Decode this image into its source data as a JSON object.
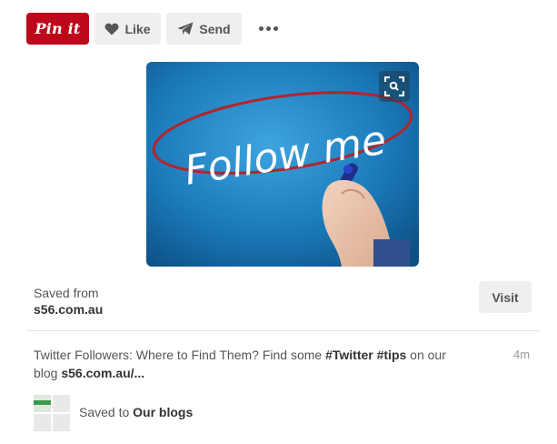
{
  "toolbar": {
    "pin_label": "Pin it",
    "like_label": "Like",
    "send_label": "Send"
  },
  "pin": {
    "image_text": "Follow me",
    "saved_from_label": "Saved from",
    "domain": "s56.com.au",
    "visit_label": "Visit",
    "description_text_1": "Twitter Followers: Where to Find Them? Find some ",
    "hashtag_1": "#Twitter",
    "hashtag_2": "#tips",
    "description_text_2": " on our blog ",
    "description_link": "s56.com.au/...",
    "timestamp": "4m",
    "saved_to_label": "Saved to ",
    "board_name": "Our blogs"
  },
  "colors": {
    "pin_red": "#bd081c",
    "button_gray": "#efefef",
    "image_blue": "#1a78b8"
  }
}
